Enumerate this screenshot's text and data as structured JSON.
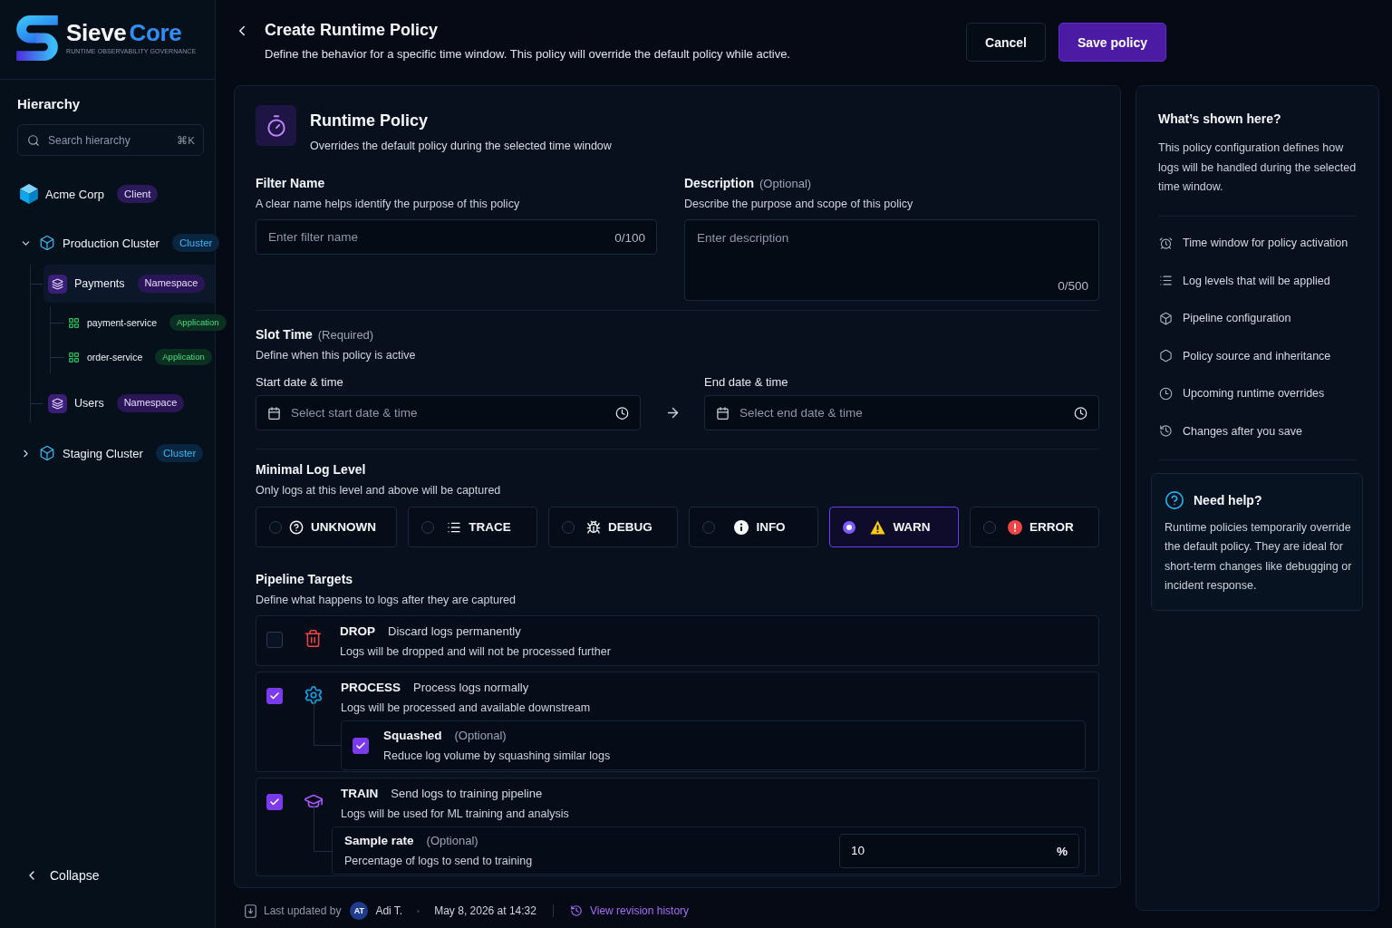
{
  "brand": {
    "name": "Sieve",
    "accent": "Core",
    "tagline": "RUNTIME OBSERVABILITY GOVERNANCE"
  },
  "sidebar": {
    "title": "Hierarchy",
    "search": {
      "placeholder": "Search hierarchy",
      "shortcut": "⌘K"
    },
    "tree": [
      {
        "label": "Acme Corp",
        "tag": "Client",
        "kind": "client",
        "selected": false
      },
      {
        "label": "Production Cluster",
        "tag": "Cluster",
        "kind": "cluster",
        "expanded": true,
        "selected": false,
        "children": [
          {
            "label": "Payments",
            "tag": "Namespace",
            "kind": "namespace",
            "selected": true,
            "children": [
              {
                "label": "payment-service",
                "tag": "Application",
                "kind": "application",
                "selected": false
              },
              {
                "label": "order-service",
                "tag": "Application",
                "kind": "application",
                "selected": false
              }
            ]
          },
          {
            "label": "Users",
            "tag": "Namespace",
            "kind": "namespace",
            "selected": false
          }
        ]
      },
      {
        "label": "Staging Cluster",
        "tag": "Cluster",
        "kind": "cluster",
        "expanded": false,
        "selected": false
      }
    ],
    "collapse": "Collapse"
  },
  "header": {
    "title": "Create Runtime Policy",
    "subtitle": "Define the behavior for a specific time window. This policy will override the default policy while active.",
    "buttons": [
      {
        "label": "Cancel",
        "kind": "secondary"
      },
      {
        "label": "Save policy",
        "kind": "primary"
      }
    ]
  },
  "policy": {
    "title": "Runtime Policy",
    "subtitle": "Overrides the default policy during the selected time window"
  },
  "filter_name": {
    "label": "Filter Name",
    "hint": "A clear name helps identify the purpose of this policy",
    "placeholder": "Enter filter name",
    "counter": "0/100"
  },
  "description": {
    "label": "Description",
    "note": "(Optional)",
    "hint": "Describe the purpose and scope of this policy",
    "placeholder": "Enter description",
    "counter": "0/500"
  },
  "slot_time": {
    "label": "Slot Time",
    "note": "(Required)",
    "hint": "Define when this policy is active",
    "start": {
      "label": "Start date & time",
      "placeholder": "Select start date & time"
    },
    "end": {
      "label": "End date & time",
      "placeholder": "Select end date & time"
    }
  },
  "log_level": {
    "label": "Minimal Log Level",
    "hint": "Only logs at this level and above will be captured",
    "options": [
      {
        "label": "UNKNOWN",
        "kind": "unknown",
        "selected": false
      },
      {
        "label": "TRACE",
        "kind": "trace",
        "selected": false
      },
      {
        "label": "DEBUG",
        "kind": "debug",
        "selected": false
      },
      {
        "label": "INFO",
        "kind": "info",
        "selected": false
      },
      {
        "label": "WARN",
        "kind": "warn",
        "selected": true
      },
      {
        "label": "ERROR",
        "kind": "error",
        "selected": false
      }
    ]
  },
  "pipeline": {
    "label": "Pipeline Targets",
    "hint": "Define what happens to logs after they are captured",
    "targets": [
      {
        "kind": "drop",
        "name": "DROP",
        "summary": "Discard logs permanently",
        "detail": "Logs will be dropped and will not be processed further",
        "checked": false
      },
      {
        "kind": "process",
        "name": "PROCESS",
        "summary": "Process logs normally",
        "detail": "Logs will be processed and available downstream",
        "checked": true,
        "option": {
          "kind": "toggle",
          "label": "Squashed",
          "note": "(Optional)",
          "detail": "Reduce log volume by squashing similar logs",
          "checked": true
        }
      },
      {
        "kind": "train",
        "name": "TRAIN",
        "summary": "Send logs to training pipeline",
        "detail": "Logs will be used for ML training and analysis",
        "checked": true,
        "option": {
          "kind": "rate",
          "label": "Sample rate",
          "note": "(Optional)",
          "detail": "Percentage of logs to send to training",
          "value": "10",
          "unit": "%"
        }
      }
    ]
  },
  "footer": {
    "updated_label": "Last updated by",
    "avatar": "AT",
    "user": "Adi T.",
    "date": "May 8, 2026 at 14:32",
    "link": "View revision history"
  },
  "info_panel": {
    "title": "What’s shown here?",
    "text": "This policy configuration defines how logs will be handled during the selected time window.",
    "items": [
      {
        "kind": "timer",
        "text": "Time window for policy activation"
      },
      {
        "kind": "levels",
        "text": "Log levels that will be applied"
      },
      {
        "kind": "pipeline",
        "text": "Pipeline configuration"
      },
      {
        "kind": "source",
        "text": "Policy source and inheritance"
      },
      {
        "kind": "upcoming",
        "text": "Upcoming runtime overrides"
      },
      {
        "kind": "changes",
        "text": "Changes after you save"
      }
    ],
    "help": {
      "title": "Need help?",
      "text": "Runtime policies temporarily override the default policy. They are ideal for short-term changes like debugging or incident response."
    }
  }
}
